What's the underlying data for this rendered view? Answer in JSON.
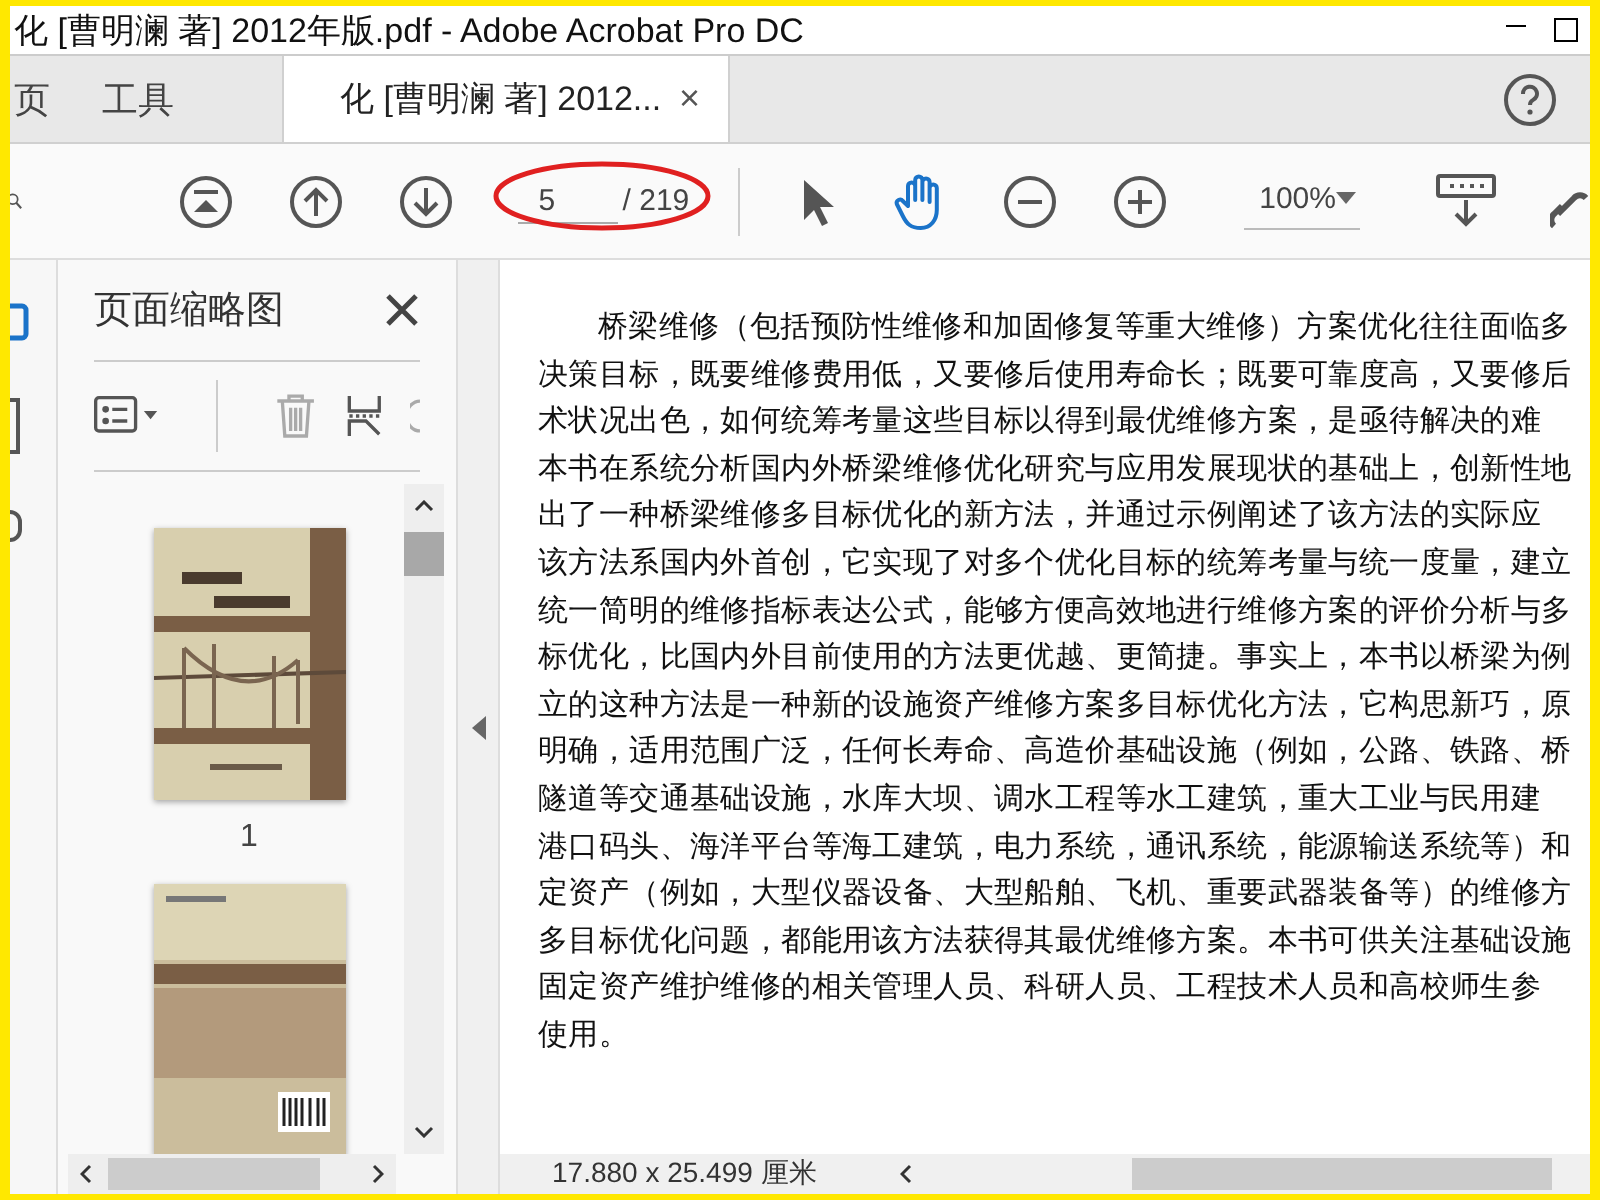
{
  "window": {
    "title": "化 [曹明澜 著] 2012年版.pdf - Adobe Acrobat Pro DC"
  },
  "tabs": [
    {
      "label": "页",
      "selected": false,
      "kind": "nav"
    },
    {
      "label": "工具",
      "selected": false,
      "kind": "nav"
    },
    {
      "label": "化 [曹明澜 著] 2012...",
      "selected": true,
      "kind": "document",
      "close": "×"
    }
  ],
  "toolbar": {
    "page_current": "5",
    "page_total": "/ 219",
    "page_marked": true,
    "pointer_tool": {
      "selected": false
    },
    "hand_tool": {
      "selected": true
    },
    "zoom": "100%"
  },
  "sidebar": {
    "title": "页面缩略图",
    "delete_disabled": true,
    "thumbnails": [
      {
        "label": "1",
        "kind": "front-cover"
      },
      {
        "kind": "back-cover"
      }
    ]
  },
  "document": {
    "lines": [
      "桥梁维修（包括预防性维修和加固修复等重大维修）方案优化往往面临多",
      "决策目标，既要维修费用低，又要修后使用寿命长；既要可靠度高，又要修后",
      "术状况出色，如何统筹考量这些目标以得到最优维修方案，是亟待解决的难",
      "本书在系统分析国内外桥梁维修优化研究与应用发展现状的基础上，创新性地",
      "出了一种桥梁维修多目标优化的新方法，并通过示例阐述了该方法的实际应",
      "该方法系国内外首创，它实现了对多个优化目标的统筹考量与统一度量，建立",
      "统一简明的维修指标表达公式，能够方便高效地进行维修方案的评价分析与多",
      "标优化，比国内外目前使用的方法更优越、更简捷。事实上，本书以桥梁为例",
      "立的这种方法是一种新的设施资产维修方案多目标优化方法，它构思新巧，原",
      "明确，适用范围广泛，任何长寿命、高造价基础设施（例如，公路、铁路、桥",
      "隧道等交通基础设施，水库大坝、调水工程等水工建筑，重大工业与民用建",
      "港口码头、海洋平台等海工建筑，电力系统，通讯系统，能源输送系统等）和",
      "定资产（例如，大型仪器设备、大型船舶、飞机、重要武器装备等）的维修方",
      "多目标优化问题，都能用该方法获得其最优维修方案。本书可供关注基础设施",
      "固定资产维护维修的相关管理人员、科研人员、工程技术人员和高校师生参",
      "使用。"
    ]
  },
  "status_bar": {
    "page_size": "17.880 x 25.499 厘米"
  }
}
